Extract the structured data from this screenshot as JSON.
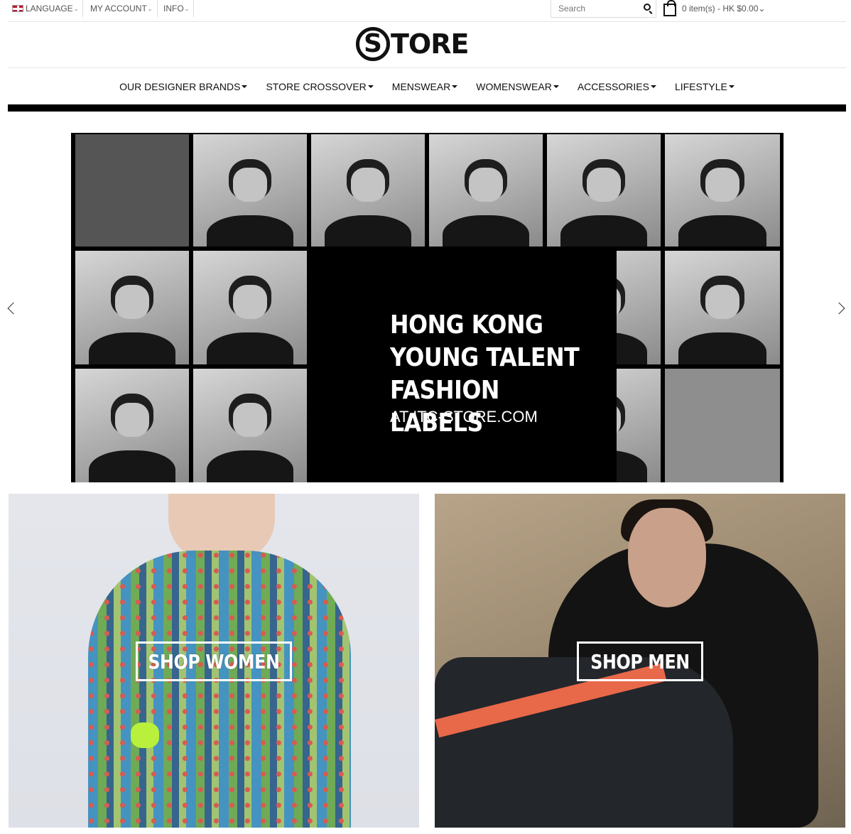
{
  "topbar": {
    "language_label": "LANGUAGE",
    "account_label": "MY ACCOUNT",
    "info_label": "INFO",
    "search_placeholder": "Search",
    "cart_label": "0 item(s) - HK $0.00",
    "chevron": "⌄"
  },
  "logo": {
    "letter": "S",
    "word": "TORE"
  },
  "nav": {
    "items": [
      {
        "label": "OUR DESIGNER BRANDS"
      },
      {
        "label": "STORE CROSSOVER"
      },
      {
        "label": "MENSWEAR"
      },
      {
        "label": "WOMENSWEAR"
      },
      {
        "label": "ACCESSORIES"
      },
      {
        "label": "LIFESTYLE"
      }
    ]
  },
  "hero": {
    "title": "HONG KONG\nYOUNG TALENT\nFASHION LABELS",
    "subtitle": "AT ITC-STORE.COM"
  },
  "promos": {
    "women_label": "SHOP WOMEN",
    "men_label": "SHOP MEN"
  },
  "icons": {
    "flag": "uk-flag-icon",
    "search": "search-icon",
    "cart": "shopping-bag-icon",
    "prev": "chevron-left-icon",
    "next": "chevron-right-icon"
  },
  "colors": {
    "text": "#111111",
    "muted": "#555555",
    "border": "#e5e5e5",
    "banner_black": "#000000",
    "cta_text": "#ffffff"
  }
}
